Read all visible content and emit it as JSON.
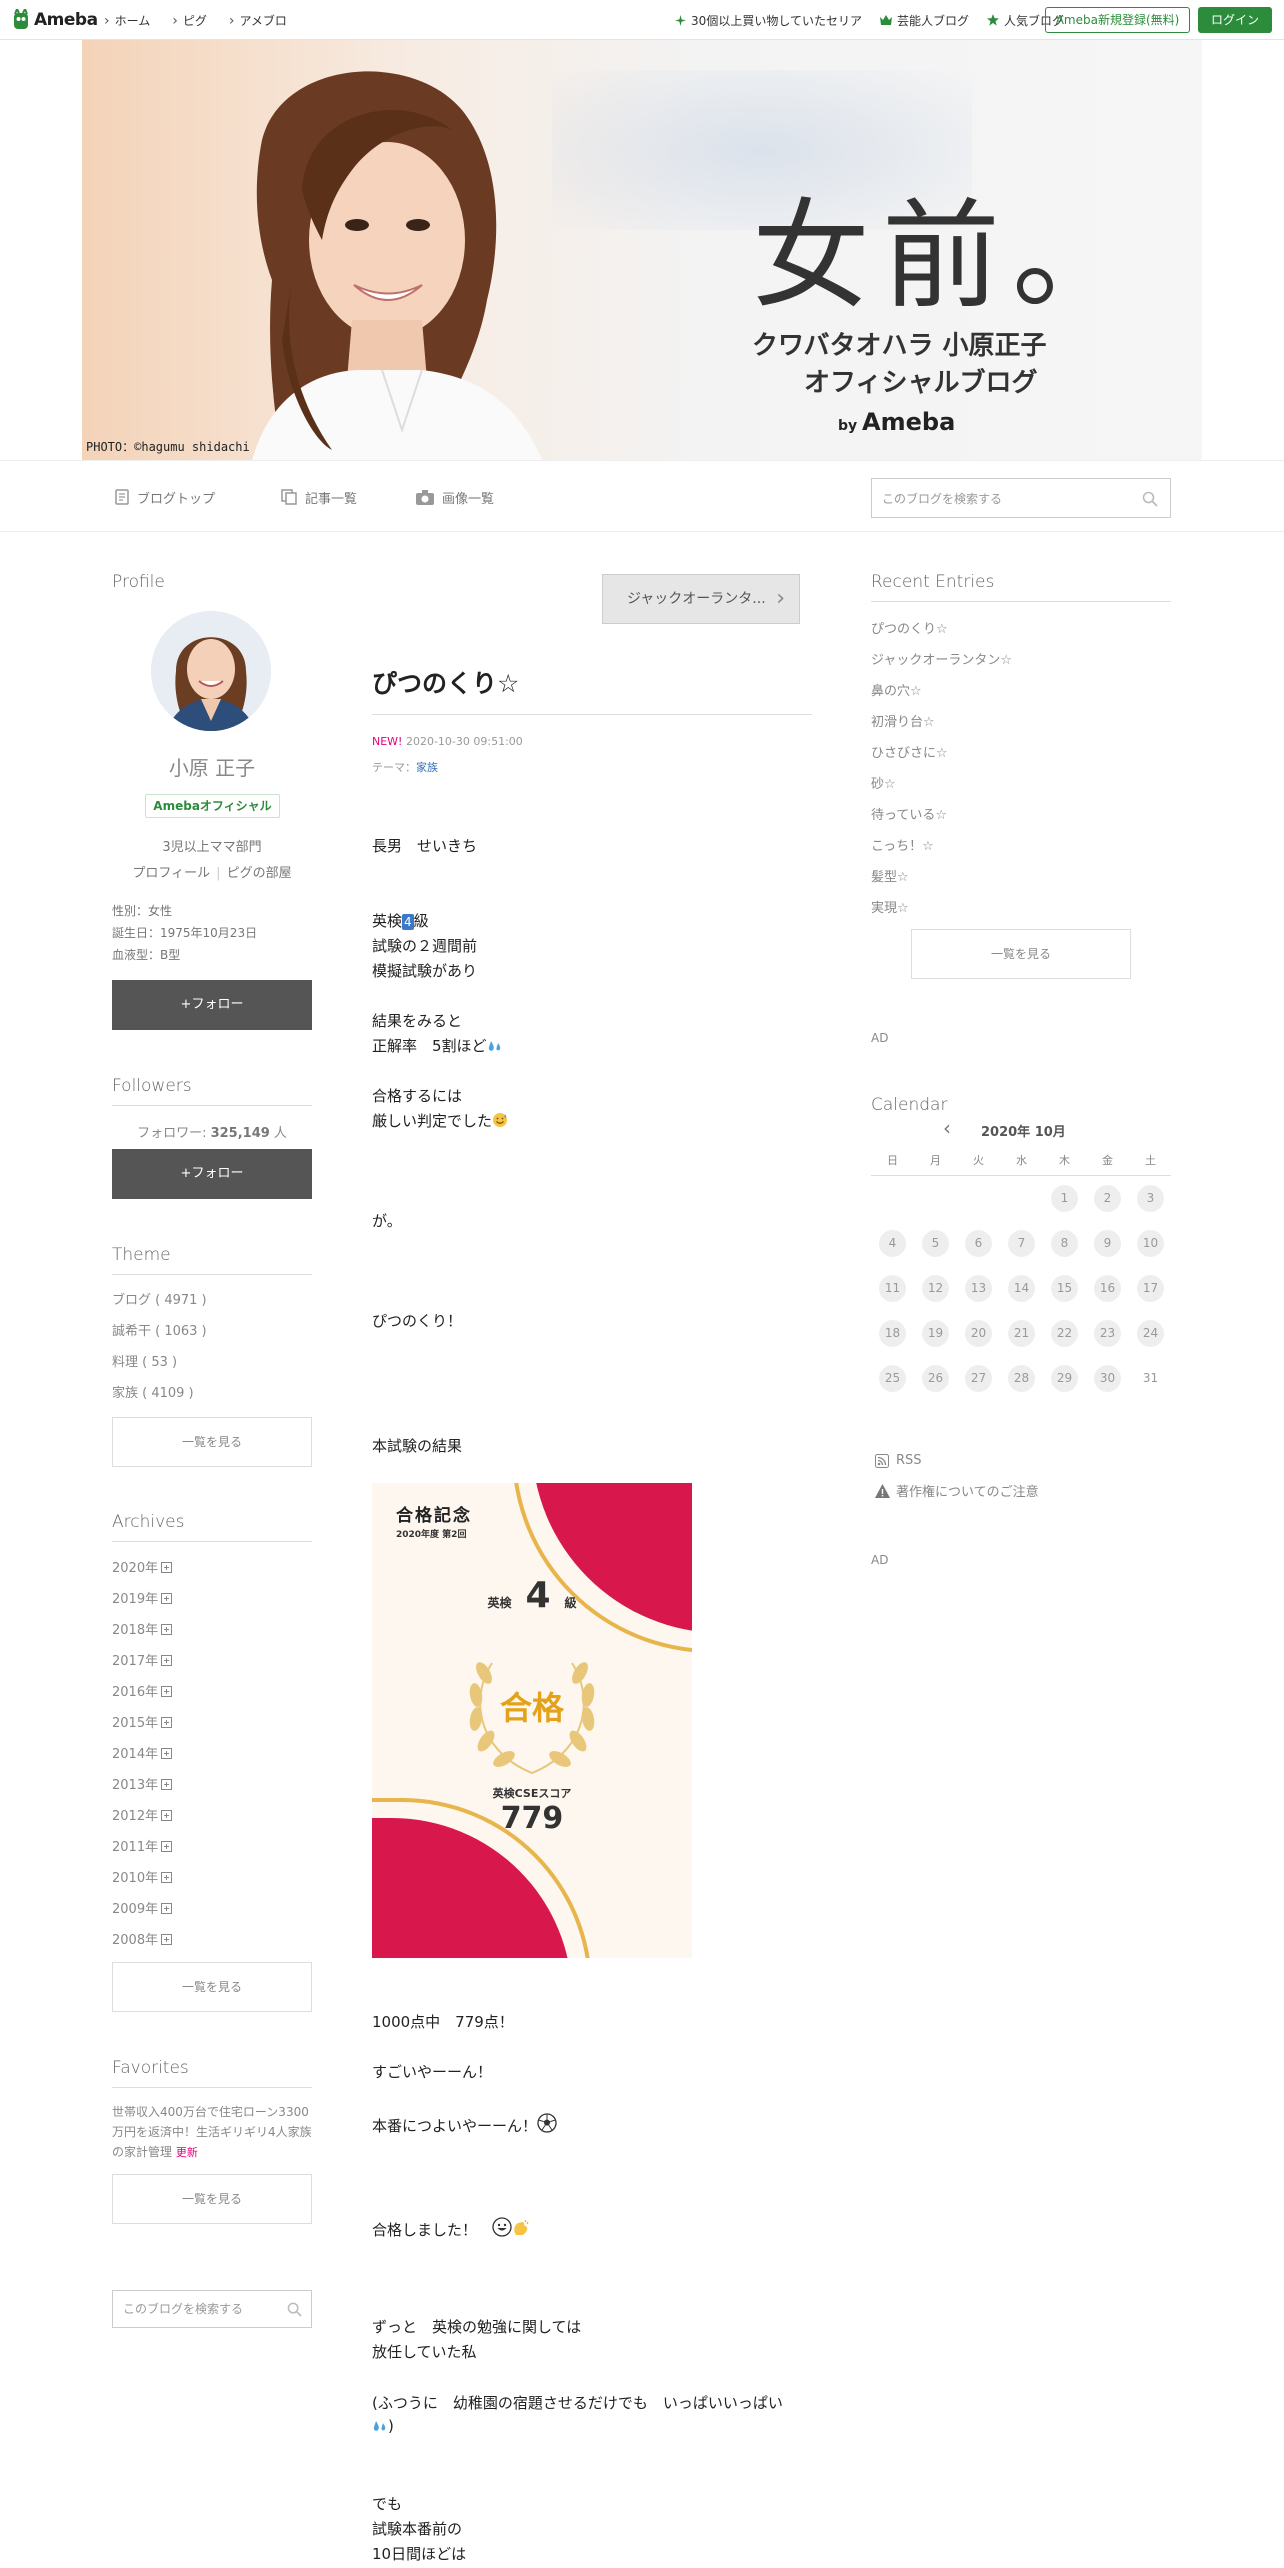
{
  "topbar": {
    "brand": "Ameba",
    "nav": [
      "ホーム",
      "ピグ",
      "アメブロ"
    ],
    "links": [
      {
        "icon": "sparkle-icon",
        "label": "30個以上買い物していたセリア"
      },
      {
        "icon": "crown-icon",
        "label": "芸能人ブログ"
      },
      {
        "icon": "star-icon",
        "label": "人気ブログ"
      }
    ],
    "register": "Ameba新規登録(無料)",
    "login": "ログイン"
  },
  "banner": {
    "title": "女前。",
    "subtitle_line1": "クワバタオハラ 小原正子",
    "subtitle_line2": "オフィシャルブログ",
    "by": "by",
    "by_brand": "Ameba",
    "credit": "PHOTO：©hagumu shidachi"
  },
  "blognav": {
    "items": [
      "ブログトップ",
      "記事一覧",
      "画像一覧"
    ],
    "search_placeholder": "このブログを検索する"
  },
  "profile": {
    "heading": "Profile",
    "name": "小原 正子",
    "badge": "Amebaオフィシャル",
    "bio": "3児以上ママ部門",
    "link_profile": "プロフィール",
    "link_room": "ピグの部屋",
    "gender": "性別：女性",
    "birthday": "誕生日：1975年10月23日",
    "blood": "血液型：B型",
    "follow": "+フォロー"
  },
  "followers": {
    "heading": "Followers",
    "label": "フォロワー: ",
    "count": "325,149",
    "unit": " 人",
    "follow": "+フォロー"
  },
  "theme": {
    "heading": "Theme",
    "items": [
      "ブログ ( 4971 )",
      "誠希干 ( 1063 )",
      "料理 ( 53 )",
      "家族 ( 4109 )"
    ],
    "more": "一覧を見る"
  },
  "archives": {
    "heading": "Archives",
    "items": [
      "2020年",
      "2019年",
      "2018年",
      "2017年",
      "2016年",
      "2015年",
      "2014年",
      "2013年",
      "2012年",
      "2011年",
      "2010年",
      "2009年",
      "2008年"
    ],
    "more": "一覧を見る"
  },
  "favorites": {
    "heading": "Favorites",
    "text": "世帯収入400万台で住宅ローン3300万円を返済中！生活ギリギリ4人家族の家計管理",
    "new": "更新",
    "more": "一覧を見る"
  },
  "side_search": {
    "placeholder": "このブログを検索する"
  },
  "entry": {
    "next_button": "ジャックオーランタ...",
    "title": "ぴつのくり☆",
    "new": "NEW!",
    "date": "2020-10-30 09:51:00",
    "theme_label": "テーマ：",
    "theme": "家族",
    "lines": {
      "l1": "長男　せいきち",
      "l2a": "英検",
      "l2b": "4",
      "l2c": "級",
      "l3": "試験の２週間前",
      "l4": "模擬試験があり",
      "l5": "結果をみると",
      "l6": "正解率　5割ほど",
      "l7": "合格するには",
      "l8": "厳しい判定でした",
      "l9": "が。",
      "l10": "ぴつのくり！",
      "l11": "本試験の結果",
      "l12": "1000点中　779点！",
      "l13": "すごいやーーん！",
      "l14": "本番につよいやーーん！",
      "l15": "合格しました！　",
      "l16": "ずっと　英検の勉強に関しては",
      "l17": "放任していた私",
      "l18": "(ふつうに　幼稚園の宿題させるだけでも　いっぱいいっぱい",
      "l19": ")",
      "l20": "でも",
      "l21": "試験本番前の",
      "l22": "10日間ほどは"
    },
    "certificate": {
      "heading": "合格記念",
      "sub": "2020年度 第2回",
      "grade_prefix": "英検",
      "grade": "4",
      "grade_suffix": "級",
      "pass": "合格",
      "score_label": "英検CSEスコア",
      "score": "779"
    }
  },
  "recent": {
    "heading": "Recent Entries",
    "items": [
      "ぴつのくり☆",
      "ジャックオーランタン☆",
      "鼻の穴☆",
      "初滑り台☆",
      "ひさびさに☆",
      "砂☆",
      "待っている☆",
      "こっち！☆",
      "髪型☆",
      "実現☆"
    ],
    "more": "一覧を見る"
  },
  "ad": {
    "label": "AD"
  },
  "calendar": {
    "heading": "Calendar",
    "month": "2020年 10月",
    "weekdays": [
      "日",
      "月",
      "火",
      "水",
      "木",
      "金",
      "土"
    ],
    "days": [
      "1",
      "2",
      "3",
      "4",
      "5",
      "6",
      "7",
      "8",
      "9",
      "10",
      "11",
      "12",
      "13",
      "14",
      "15",
      "16",
      "17",
      "18",
      "19",
      "20",
      "21",
      "22",
      "23",
      "24",
      "25",
      "26",
      "27",
      "28",
      "29",
      "30",
      "31"
    ]
  },
  "footer_links": {
    "rss": "RSS",
    "notice": "著作権についてのご注意"
  },
  "colors": {
    "accent_green": "#2d8c3c",
    "new_pink": "#e4007f",
    "link_blue": "#3570b8",
    "follow_btn": "#555555"
  }
}
